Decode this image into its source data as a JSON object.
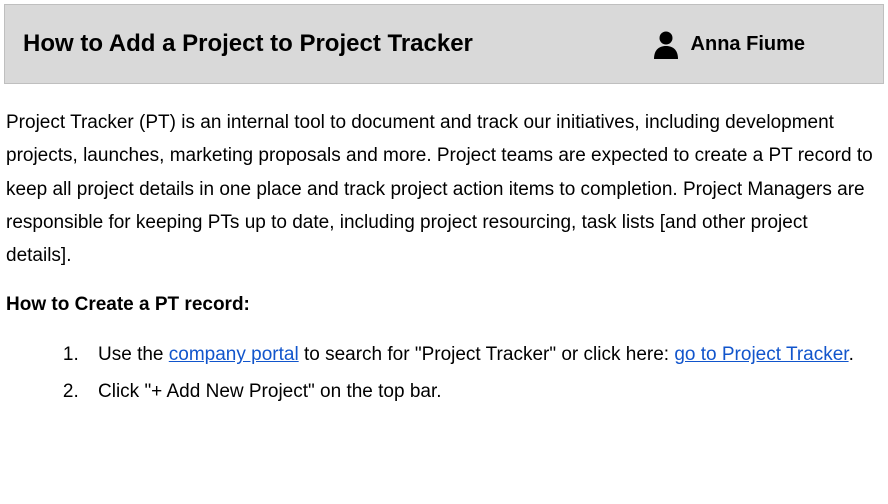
{
  "header": {
    "title": "How to Add a Project to Project Tracker",
    "author": "Anna Fiume"
  },
  "intro": "Project Tracker (PT) is an internal tool to document and track our initiatives, including development projects, launches, marketing proposals and more. Project teams are expected to create a PT record to keep all project details in one place and track project action items to completion. Project Managers are responsible for keeping PTs up to date, including project resourcing, task lists [and other project details].",
  "section_heading": "How to Create a PT record:",
  "steps": {
    "step1": {
      "pre_link1": "Use the ",
      "link1": "company portal",
      "between": " to search for \"Project Tracker\" or click here: ",
      "link2": "go to Project Tracker",
      "post": "."
    },
    "step2": "Click \"+ Add New Project\" on the top bar."
  }
}
